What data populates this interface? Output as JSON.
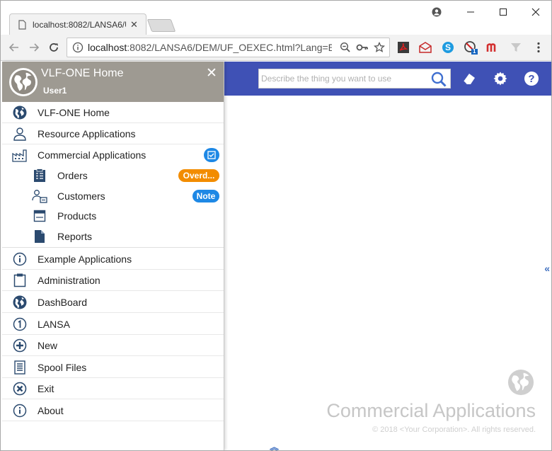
{
  "browser": {
    "tab_title": "localhost:8082/LANSA6/U",
    "url_host": "localhost",
    "url_rest": ":8082/LANSA6/DEM/UF_OEXEC.html?Lang=E...",
    "extension_badge": "1"
  },
  "header": {
    "search_placeholder": "Describe the thing you want to use"
  },
  "menu": {
    "title": "VLF-ONE Home",
    "user": "User1",
    "items": [
      {
        "label": "VLF-ONE Home",
        "icon": "globe-icon"
      },
      {
        "label": "Resource Applications",
        "icon": "person-icon"
      },
      {
        "label": "Commercial Applications",
        "icon": "factory-icon"
      },
      {
        "label": "Orders",
        "icon": "clipboard-icon",
        "badge": "Overd..."
      },
      {
        "label": "Customers",
        "icon": "people-icon",
        "badge": "Note"
      },
      {
        "label": "Products",
        "icon": "box-icon"
      },
      {
        "label": "Reports",
        "icon": "document-icon"
      },
      {
        "label": "Example Applications",
        "icon": "info-icon"
      },
      {
        "label": "Administration",
        "icon": "clipboard-icon"
      },
      {
        "label": "DashBoard",
        "icon": "globe-icon"
      },
      {
        "label": "LANSA",
        "icon": "number-one-icon"
      },
      {
        "label": "New",
        "icon": "plus-icon"
      },
      {
        "label": "Spool Files",
        "icon": "list-icon"
      },
      {
        "label": "Exit",
        "icon": "close-circle-icon"
      },
      {
        "label": "About",
        "icon": "info-icon"
      }
    ]
  },
  "content": {
    "brand_title": "Commercial Applications",
    "copyright": "© 2018 <Your Corporation>. All rights reserved."
  },
  "colors": {
    "appbar": "#3f51b5",
    "menu_header": "#9e9a92",
    "badge_orange": "#f28c00",
    "badge_blue": "#1e88e5"
  }
}
